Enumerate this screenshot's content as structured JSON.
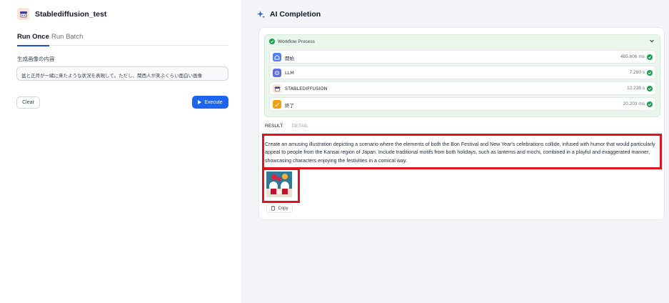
{
  "app": {
    "title": "Stablediffusion_test"
  },
  "tabs": [
    {
      "label": "Run Once"
    },
    {
      "label": "Run Batch"
    }
  ],
  "form": {
    "label": "生成画像の内容",
    "value": "盆と正月が一緒に来たような状況を表現して。ただし、関西人が笑ぶくらい面白い画像",
    "clear_label": "Clear",
    "execute_label": "Execute"
  },
  "completion": {
    "title": "AI Completion",
    "workflow": {
      "label": "Workflow Process",
      "status_color": "#16a34a",
      "nodes": [
        {
          "name": "開始",
          "time": "485.606 ms",
          "icon": "home-icon",
          "color": "#4f7df5"
        },
        {
          "name": "LLM",
          "time": "7.280 s",
          "icon": "llm-icon",
          "color": "#5b6ee8"
        },
        {
          "name": "STABLEDIFFUSION",
          "time": "12.238 s",
          "icon": "stablediffusion-icon",
          "color": "#fde2d6"
        },
        {
          "name": "終了",
          "time": "20.203 ms",
          "icon": "end-icon",
          "color": "#f59e0b"
        }
      ]
    },
    "result_tabs": [
      {
        "label": "RESULT"
      },
      {
        "label": "DETAIL"
      }
    ],
    "result_text": "Create an amusing illustration depicting a scenario where the elements of both the Bon Festival and New Year's celebrations collide, infused with humor that would particularly appeal to people from the Kansai region of Japan. Include traditional motifs from both holidays, such as lanterns and mochi, combined in a playful and exaggerated manner, showcasing characters enjoying the festivities in a comical way.",
    "copy_label": "Copy"
  },
  "colors": {
    "accent": "#1d64f0",
    "highlight": "#e0141e",
    "success": "#16a34a"
  }
}
